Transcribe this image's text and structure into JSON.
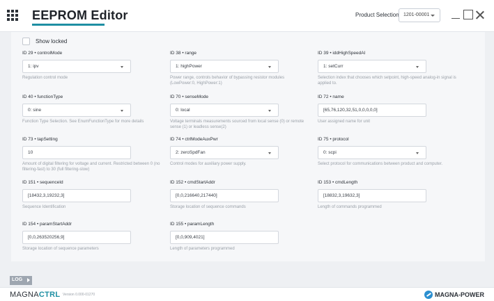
{
  "app": {
    "title": "EEPROM Editor",
    "product_label": "Product Selection:",
    "product_value": "1201-00001"
  },
  "show_locked_label": "Show locked",
  "fields": [
    {
      "label": "ID 29 • controlMode",
      "value": "1: ipv",
      "type": "select",
      "desc": "Regulation control mode"
    },
    {
      "label": "ID 38 • range",
      "value": "1: highPower",
      "type": "select",
      "desc": "Power range, controls behavior of bypassing resistor modules (LowPower:0, HighPower:1)"
    },
    {
      "label": "ID 39 • iddHighSpeedAI",
      "value": "1: setCurr",
      "type": "select",
      "desc": "Selection index that chooses which setpoint, high-speed analog-in signal is applied to."
    },
    {
      "label": "ID 40 • functionType",
      "value": "0: sine",
      "type": "select",
      "desc": "Function Type Selection. See EnumFunctionType for more details"
    },
    {
      "label": "ID 70 • senseMode",
      "value": "0: local",
      "type": "select",
      "desc": "Voltage terminals measurements sourced from local sense (0) or remote sense (1) or leadless sense(2)"
    },
    {
      "label": "ID 72 • name",
      "value": "[65,76,120,32,51,0,0,0,0,0]",
      "type": "input",
      "desc": "User assigned name for unit"
    },
    {
      "label": "ID 73 • tapSetting",
      "value": "10",
      "type": "input",
      "desc": "Amount of digital filtering for voltage and current. Restricted between 0 (no filtering-fast) to 30 (full filtering-slow)"
    },
    {
      "label": "ID 74 • ctrlModeAuxPwr",
      "value": "2: zeroSpdFan",
      "type": "select",
      "desc": "Control modes for auxiliary power supply."
    },
    {
      "label": "ID 75 • protocol",
      "value": "0: scpi",
      "type": "select",
      "desc": "Select protocol for communications between product and computer."
    },
    {
      "label": "ID 151 • sequenceId",
      "value": "[18432,3,19232,3]",
      "type": "input",
      "desc": "Sequence Identification"
    },
    {
      "label": "ID 152 • cmdStartAddr",
      "value": "[0,0,216640,217440]",
      "type": "input",
      "desc": "Storage location of sequence commands"
    },
    {
      "label": "ID 153 • cmdLength",
      "value": "[18832,3,19632,3]",
      "type": "input",
      "desc": "Length of commands programmed"
    },
    {
      "label": "ID 154 • paramStartAddr",
      "value": "[0,0,263520256,9]",
      "type": "input",
      "desc": "Storage location of sequence parameters"
    },
    {
      "label": "ID 155 • paramLength",
      "value": "[0,0,909,4021]",
      "type": "input",
      "desc": "Length of parameters programmed"
    }
  ],
  "log_label": "LOG",
  "footer": {
    "brand_part1": "MAGNA",
    "brand_part2": "CTRL",
    "version": "Version 0.000-01270",
    "company": "MAGNA-POWER"
  },
  "colors": {
    "accent": "#1e8fa3",
    "logo_blue": "#2b8fd0"
  },
  "icons": {
    "menu": "grid-menu-icon",
    "minimize": "minimize-icon",
    "maximize": "maximize-icon",
    "close": "close-icon"
  }
}
